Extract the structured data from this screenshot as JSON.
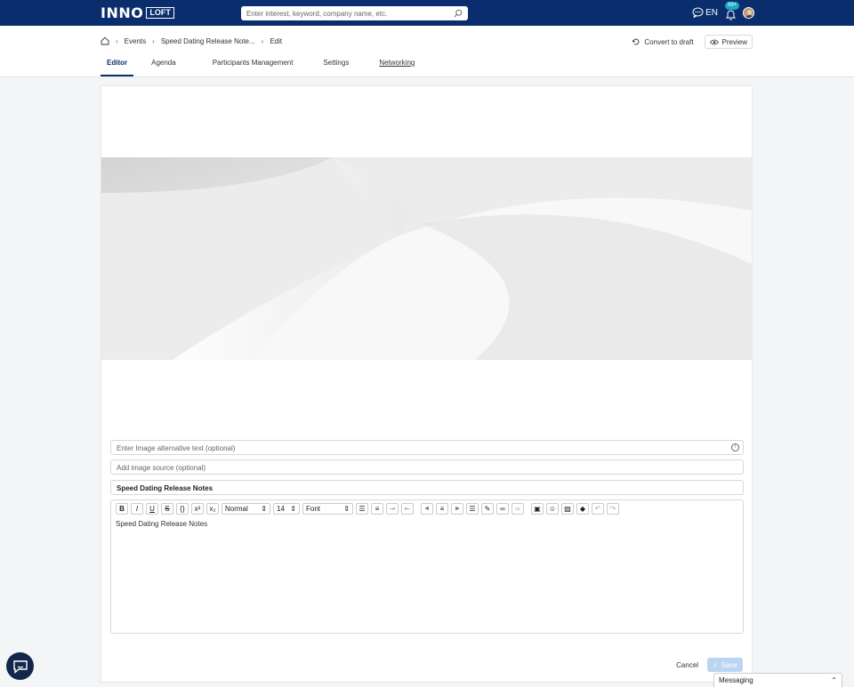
{
  "header": {
    "logo_main": "INNO",
    "logo_sub": "LOFT",
    "search_placeholder": "Enter interest, keyword, company name, etc.",
    "language": "EN",
    "notification_count": "99+"
  },
  "breadcrumb": {
    "items": [
      "Events",
      "Speed Dating Release Note...",
      "Edit"
    ]
  },
  "actions": {
    "convert_label": "Convert to draft",
    "preview_label": "Preview"
  },
  "tabs": [
    {
      "label": "Editor",
      "active": true
    },
    {
      "label": "Agenda"
    },
    {
      "label": "Participants Management"
    },
    {
      "label": "Settings"
    },
    {
      "label": "Networking"
    }
  ],
  "form": {
    "alt_text_placeholder": "Enter Image alternative text (optional)",
    "image_source_placeholder": "Add image source (optional)",
    "title_value": "Speed Dating Release Notes"
  },
  "editor": {
    "format_select": "Normal",
    "size_select": "14",
    "font_select": "Font",
    "content": "Speed Dating Release Notes"
  },
  "footer": {
    "cancel_label": "Cancel",
    "save_label": "Save"
  },
  "messaging": {
    "label": "Messaging"
  },
  "colors": {
    "topbar": "#0a2d6e",
    "save_disabled": "#b9d5f2"
  }
}
